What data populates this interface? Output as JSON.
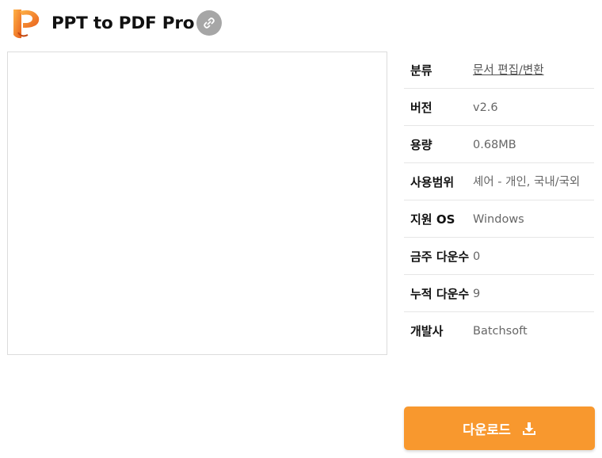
{
  "header": {
    "title": "PPT to PDF Pro",
    "logo_icon": "orange-p-logo-icon",
    "link_icon": "link-icon"
  },
  "info": {
    "rows": [
      {
        "key": "분류",
        "value": "문서 편집/변환",
        "is_link": true
      },
      {
        "key": "버전",
        "value": "v2.6"
      },
      {
        "key": "용량",
        "value": "0.68MB"
      },
      {
        "key": "사용범위",
        "value": "셰어 - 개인, 국내/국외"
      },
      {
        "key": "지원 OS",
        "value": "Windows"
      },
      {
        "key": "금주 다운수",
        "value": "0"
      },
      {
        "key": "누적 다운수",
        "value": "9"
      },
      {
        "key": "개발사",
        "value": "Batchsoft"
      }
    ]
  },
  "download": {
    "label": "다운로드",
    "icon": "download-icon"
  },
  "colors": {
    "accent": "#f8982e",
    "link_button": "#a6a6a6",
    "border": "#dcdcdc"
  }
}
